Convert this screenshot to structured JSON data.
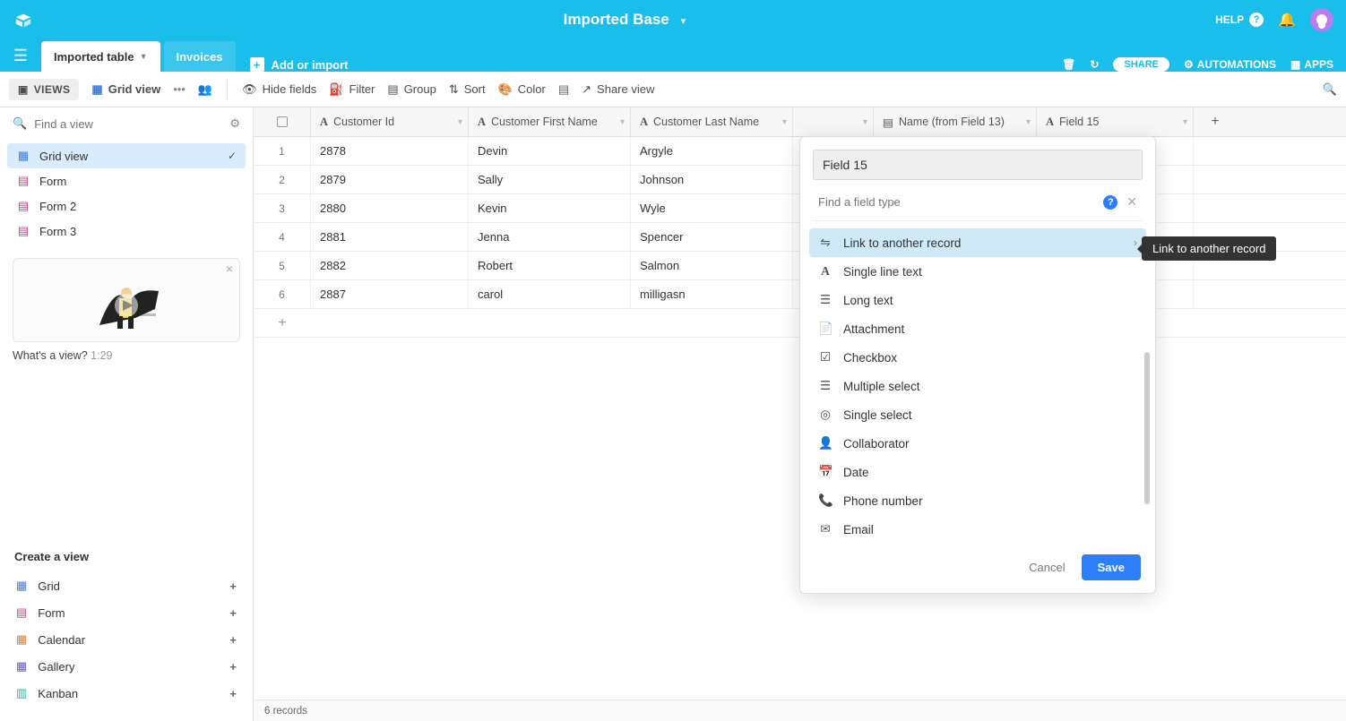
{
  "header": {
    "base_title": "Imported Base",
    "help": "HELP"
  },
  "tabs": {
    "items": [
      {
        "label": "Imported table",
        "active": true
      },
      {
        "label": "Invoices",
        "active": false
      }
    ],
    "add_or_import": "Add or import",
    "share": "SHARE",
    "automations": "AUTOMATIONS",
    "apps": "APPS"
  },
  "toolbar": {
    "views": "VIEWS",
    "grid_view": "Grid view",
    "hide_fields": "Hide fields",
    "filter": "Filter",
    "group": "Group",
    "sort": "Sort",
    "color": "Color",
    "share_view": "Share view"
  },
  "sidebar": {
    "search_placeholder": "Find a view",
    "views": [
      {
        "label": "Grid view",
        "icon": "grid",
        "active": true
      },
      {
        "label": "Form",
        "icon": "form",
        "active": false
      },
      {
        "label": "Form 2",
        "icon": "form",
        "active": false
      },
      {
        "label": "Form 3",
        "icon": "form",
        "active": false
      }
    ],
    "promo_text": "What's a view?",
    "promo_time": "1:29",
    "create_title": "Create a view",
    "create_items": [
      {
        "label": "Grid",
        "color": "ci-blue"
      },
      {
        "label": "Form",
        "color": "ci-pink"
      },
      {
        "label": "Calendar",
        "color": "ci-orange"
      },
      {
        "label": "Gallery",
        "color": "ci-purple"
      },
      {
        "label": "Kanban",
        "color": "ci-teal"
      }
    ]
  },
  "grid": {
    "columns": [
      "Customer Id",
      "Customer First Name",
      "Customer Last Name",
      "",
      "Name (from Field 13)",
      "Field 15"
    ],
    "rows": [
      {
        "n": "1",
        "id": "2878",
        "first": "Devin",
        "last": "Argyle"
      },
      {
        "n": "2",
        "id": "2879",
        "first": "Sally",
        "last": "Johnson"
      },
      {
        "n": "3",
        "id": "2880",
        "first": "Kevin",
        "last": "Wyle"
      },
      {
        "n": "4",
        "id": "2881",
        "first": "Jenna",
        "last": "Spencer"
      },
      {
        "n": "5",
        "id": "2882",
        "first": "Robert",
        "last": "Salmon"
      },
      {
        "n": "6",
        "id": "2887",
        "first": "carol",
        "last": "milligasn"
      }
    ],
    "footer": "6 records"
  },
  "popover": {
    "field_name_value": "Field 15",
    "search_placeholder": "Find a field type",
    "types": [
      "Link to another record",
      "Single line text",
      "Long text",
      "Attachment",
      "Checkbox",
      "Multiple select",
      "Single select",
      "Collaborator",
      "Date",
      "Phone number",
      "Email"
    ],
    "cancel": "Cancel",
    "save": "Save"
  },
  "tooltip": "Link to another record"
}
